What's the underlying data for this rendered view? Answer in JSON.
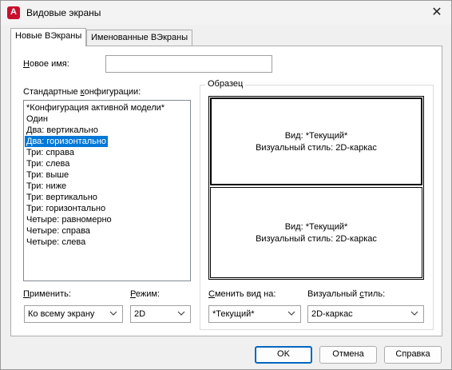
{
  "window": {
    "title": "Видовые экраны",
    "app_icon_letter": "A",
    "close_glyph": "✕"
  },
  "tabs": [
    {
      "label": "Новые ВЭкраны",
      "active": true
    },
    {
      "label": "Именованные ВЭкраны",
      "active": false
    }
  ],
  "new_name": {
    "label_prefix": "Н",
    "label_rest": "овое имя:",
    "value": ""
  },
  "configs": {
    "label_pre": "Стандартные ",
    "label_u": "к",
    "label_post": "онфигурации:",
    "items": [
      "*Конфигурация активной модели*",
      "Один",
      "Два: вертикально",
      "Два: горизонтально",
      "Три: справа",
      "Три: слева",
      "Три: выше",
      "Три: ниже",
      "Три: вертикально",
      "Три: горизонтально",
      "Четыре: равномерно",
      "Четыре: справа",
      "Четыре: слева"
    ],
    "selected_index": 3
  },
  "preview": {
    "label": "Образец",
    "viewports": [
      {
        "view": "Вид: *Текущий*",
        "style": "Визуальный стиль: 2D-каркас",
        "active": true
      },
      {
        "view": "Вид: *Текущий*",
        "style": "Визуальный стиль: 2D-каркас",
        "active": false
      }
    ]
  },
  "apply": {
    "label_u": "П",
    "label_rest": "рименить:",
    "value": "Ко всему экрану"
  },
  "mode": {
    "label_u": "Р",
    "label_rest": "ежим:",
    "value": "2D"
  },
  "change_view": {
    "label_u": "С",
    "label_rest": "менить вид на:",
    "value": "*Текущий*"
  },
  "visual_style": {
    "label_pre": "Визуальный ",
    "label_u": "с",
    "label_post": "тиль:",
    "value": "2D-каркас"
  },
  "buttons": {
    "ok": "OK",
    "cancel": "Отмена",
    "help": "Справка"
  }
}
